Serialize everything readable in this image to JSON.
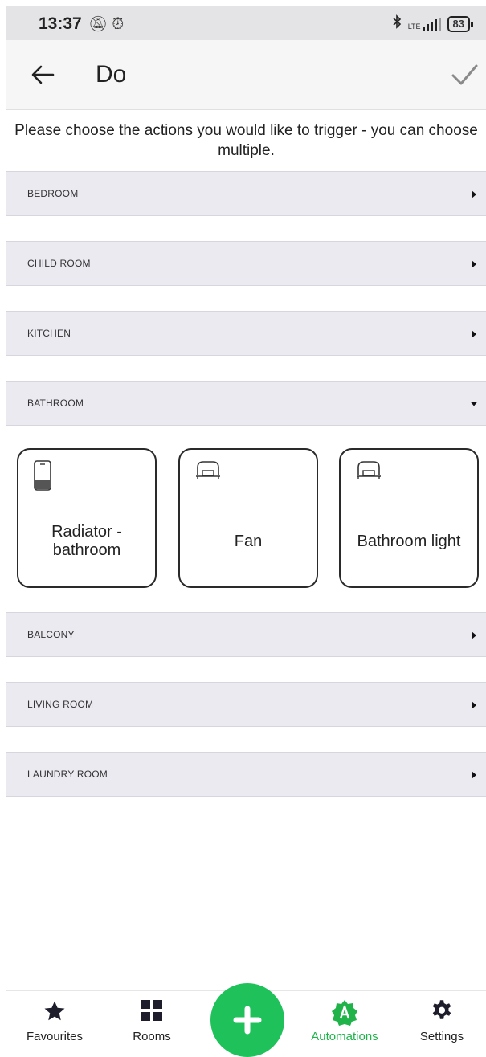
{
  "status_bar": {
    "time": "13:37",
    "left_icons": [
      "mute-notifications-icon",
      "alarm-icon"
    ],
    "right_icons": [
      "bluetooth-icon",
      "lte-signal-icon",
      "battery-icon"
    ],
    "network": "LTE",
    "battery": "83"
  },
  "app_bar": {
    "title": "Do",
    "back_icon": "arrow-left-icon",
    "confirm_icon": "check-icon"
  },
  "intro_text": "Please choose the actions you would like to trigger - you can choose multiple.",
  "sections": [
    {
      "label": "BEDROOM",
      "expanded": false
    },
    {
      "label": "CHILD ROOM",
      "expanded": false
    },
    {
      "label": "KITCHEN",
      "expanded": false
    },
    {
      "label": "BATHROOM",
      "expanded": true
    },
    {
      "label": "BALCONY",
      "expanded": false
    },
    {
      "label": "LIVING ROOM",
      "expanded": false
    },
    {
      "label": "LAUNDRY ROOM",
      "expanded": false
    }
  ],
  "bathroom_devices": [
    {
      "name": "Radiator - bathroom",
      "icon": "radiator-device-icon"
    },
    {
      "name": "Fan",
      "icon": "plug-device-icon"
    },
    {
      "name": "Bathroom light",
      "icon": "plug-device-icon"
    }
  ],
  "bottom_nav": {
    "items": [
      {
        "label": "Favourites",
        "icon": "star-icon",
        "active": false
      },
      {
        "label": "Rooms",
        "icon": "grid-icon",
        "active": false
      },
      {
        "label": "Automations",
        "icon": "automation-badge-icon",
        "active": true
      },
      {
        "label": "Settings",
        "icon": "gear-icon",
        "active": false
      }
    ],
    "fab_icon": "plus-icon"
  },
  "colors": {
    "accent": "#1fc25a",
    "active_nav": "#1fb34a",
    "section_bg": "#eaeaf0"
  }
}
